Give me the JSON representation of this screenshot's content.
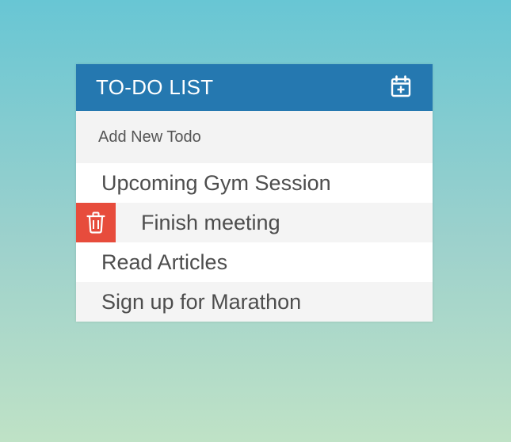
{
  "header": {
    "title": "TO-DO LIST",
    "add_icon": "calendar-plus-icon"
  },
  "input": {
    "placeholder": "Add New Todo",
    "value": ""
  },
  "todos": [
    {
      "text": "Upcoming Gym Session",
      "hovered": false
    },
    {
      "text": "Finish meeting",
      "hovered": true,
      "delete_icon": "trash-icon"
    },
    {
      "text": "Read Articles",
      "hovered": false
    },
    {
      "text": "Sign up for Marathon",
      "hovered": false
    }
  ],
  "colors": {
    "header_bg": "#2578b0",
    "delete_bg": "#e74c3c",
    "text": "#4d4d4d"
  }
}
